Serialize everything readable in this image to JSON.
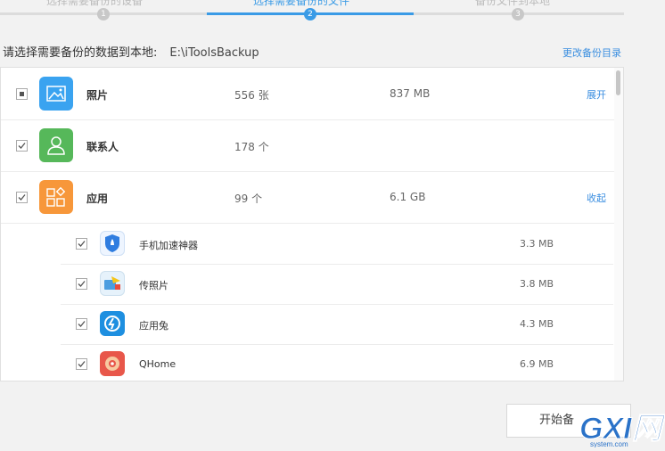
{
  "stepper": {
    "steps": [
      {
        "number": "1",
        "label": "选择需要备份的设备",
        "active": false
      },
      {
        "number": "2",
        "label": "选择需要备份的文件",
        "active": true
      },
      {
        "number": "3",
        "label": "备份文件到本地",
        "active": false
      }
    ]
  },
  "header": {
    "prompt": "请选择需要备份的数据到本地:",
    "path": "E:\\iToolsBackup",
    "change_dir_label": "更改备份目录"
  },
  "categories": [
    {
      "name": "照片",
      "count": "556 张",
      "size": "837 MB",
      "action": "展开",
      "checkbox": "partial",
      "icon": "photo-icon",
      "color": "#3aa3f0"
    },
    {
      "name": "联系人",
      "count": "178 个",
      "size": "",
      "action": "",
      "checkbox": "checked",
      "icon": "contact-icon",
      "color": "#56b85a"
    },
    {
      "name": "应用",
      "count": "99 个",
      "size": "6.1 GB",
      "action": "收起",
      "checkbox": "checked",
      "icon": "apps-icon",
      "color": "#f7973a"
    }
  ],
  "apps": [
    {
      "name": "手机加速神器",
      "size": "3.3 MB",
      "icon": "rocket-shield-icon"
    },
    {
      "name": "传照片",
      "size": "3.8 MB",
      "icon": "photo-transfer-icon"
    },
    {
      "name": "应用兔",
      "size": "4.3 MB",
      "icon": "rabbit-app-icon"
    },
    {
      "name": "QHome",
      "size": "6.9 MB",
      "icon": "qhome-icon"
    }
  ],
  "footer": {
    "start_button_label": "开始备",
    "watermark_text": "GXI网",
    "watermark_sub": "system.com"
  }
}
